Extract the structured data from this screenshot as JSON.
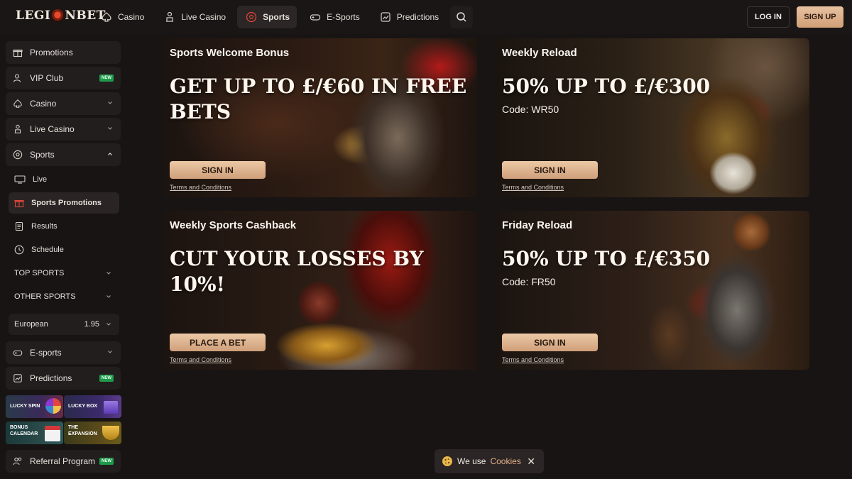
{
  "header": {
    "logo_left": "LEGI",
    "logo_right": "NBET",
    "nav": [
      {
        "label": "Casino",
        "icon": "spade-icon"
      },
      {
        "label": "Live Casino",
        "icon": "dealer-icon"
      },
      {
        "label": "Sports",
        "icon": "soccer-ball-icon",
        "active": true
      },
      {
        "label": "E-Sports",
        "icon": "gamepad-icon"
      },
      {
        "label": "Predictions",
        "icon": "chart-icon"
      }
    ],
    "login_label": "LOG IN",
    "signup_label": "SIGN UP"
  },
  "sidebar": {
    "promotions": "Promotions",
    "vip_club": "VIP Club",
    "vip_badge": "NEW",
    "casino": "Casino",
    "live_casino": "Live Casino",
    "sports": "Sports",
    "sub": {
      "live": "Live",
      "sports_promotions": "Sports Promotions",
      "results": "Results",
      "schedule": "Schedule"
    },
    "top_sports": "TOP SPORTS",
    "other_sports": "OTHER SPORTS",
    "odds_format": "European",
    "odds_value": "1.95",
    "esports": "E-sports",
    "predictions": "Predictions",
    "predictions_badge": "NEW",
    "tiles": {
      "lucky_spin": "LUCKY SPIN",
      "lucky_box": "LUCKY BOX",
      "bonus_calendar_1": "BONUS",
      "bonus_calendar_2": "CALENDAR",
      "expansion_1": "THE",
      "expansion_2": "EXPANSION"
    },
    "referral": "Referral Program",
    "referral_badge": "NEW"
  },
  "cards": [
    {
      "title": "Sports Welcome Bonus",
      "headline": "GET UP TO £/€60 IN FREE BETS",
      "code": "",
      "button": "SIGN IN",
      "terms": "Terms and Conditions"
    },
    {
      "title": "Weekly Reload",
      "headline": "50% UP TO £/€300",
      "code": "Code: WR50",
      "button": "SIGN IN",
      "terms": "Terms and Conditions"
    },
    {
      "title": "Weekly Sports Cashback",
      "headline": "CUT YOUR LOSSES BY 10%!",
      "code": "",
      "button": "PLACE A BET",
      "terms": "Terms and Conditions"
    },
    {
      "title": "Friday Reload",
      "headline": "50% UP TO £/€350",
      "code": "Code: FR50",
      "button": "SIGN IN",
      "terms": "Terms and Conditions"
    }
  ],
  "cookie": {
    "text": "We use",
    "link": "Cookies",
    "close": "✕"
  },
  "colors": {
    "accent": "#d9aa84",
    "background": "#181414",
    "badge_green": "#1f9a4b"
  }
}
